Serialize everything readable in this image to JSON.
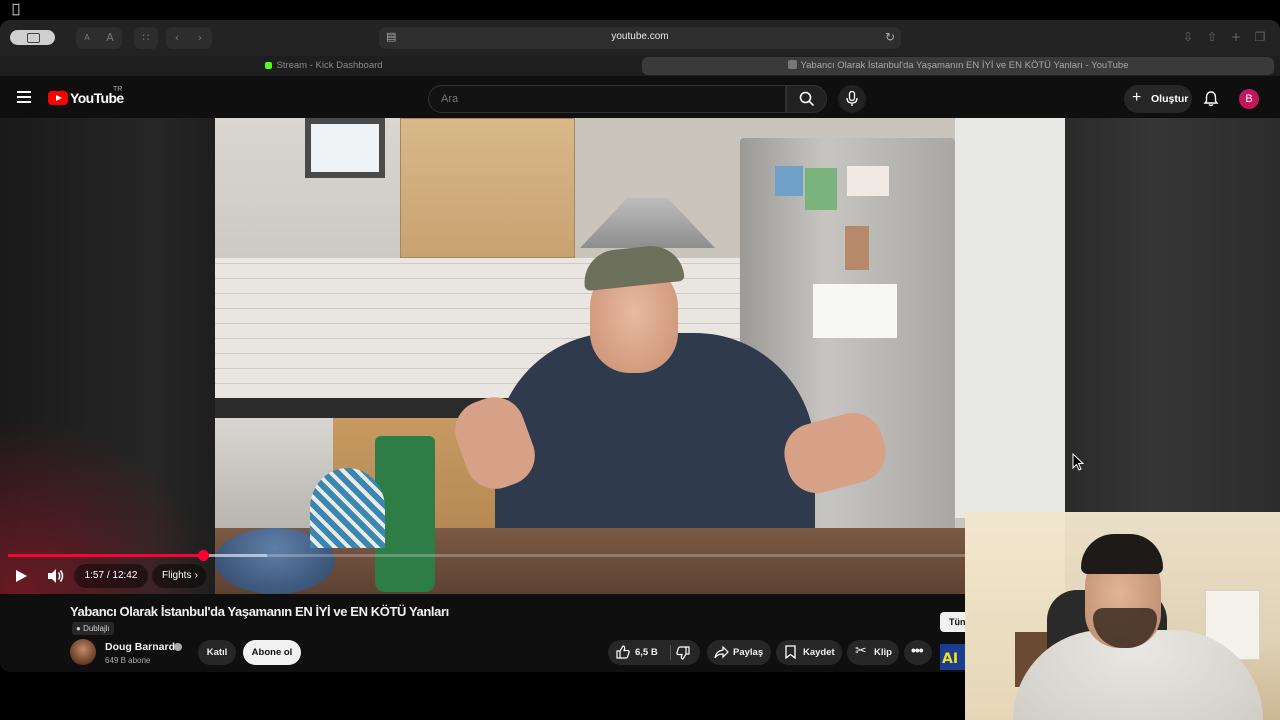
{
  "browser": {
    "url": "youtube.com",
    "tabs": [
      {
        "label": "Stream - Kick Dashboard",
        "active": false
      },
      {
        "label": "Yabancı Olarak İstanbul'da Yaşamanın EN İYİ ve EN KÖTÜ Yanları - YouTube",
        "active": true
      }
    ],
    "text_size_small": "A",
    "text_size_large": "A"
  },
  "header": {
    "logo_text": "YouTube",
    "region": "TR",
    "search_placeholder": "Ara",
    "create_label": "Oluştur",
    "avatar_letter": "B"
  },
  "player": {
    "time": "1:57 / 12:42",
    "chapter": "Flights",
    "progress": 0.154,
    "buffered": 0.205
  },
  "video": {
    "title": "Yabancı Olarak İstanbul'da Yaşamanın EN İYİ ve EN KÖTÜ Yanları",
    "dub_label": "Dublajlı",
    "channel_name": "Doug Barnard",
    "subscribers": "649 B abone",
    "join_label": "Katıl",
    "subscribe_label": "Abone ol",
    "likes": "6,5 B",
    "share_label": "Paylaş",
    "save_label": "Kaydet",
    "clip_label": "Klip",
    "more_tab": "Tün",
    "ad_text": "AI"
  },
  "colors": {
    "brand_red": "#ff0000",
    "progress": "#ff0033",
    "avatar": "#c2185b",
    "background": "#0f0f0f"
  }
}
